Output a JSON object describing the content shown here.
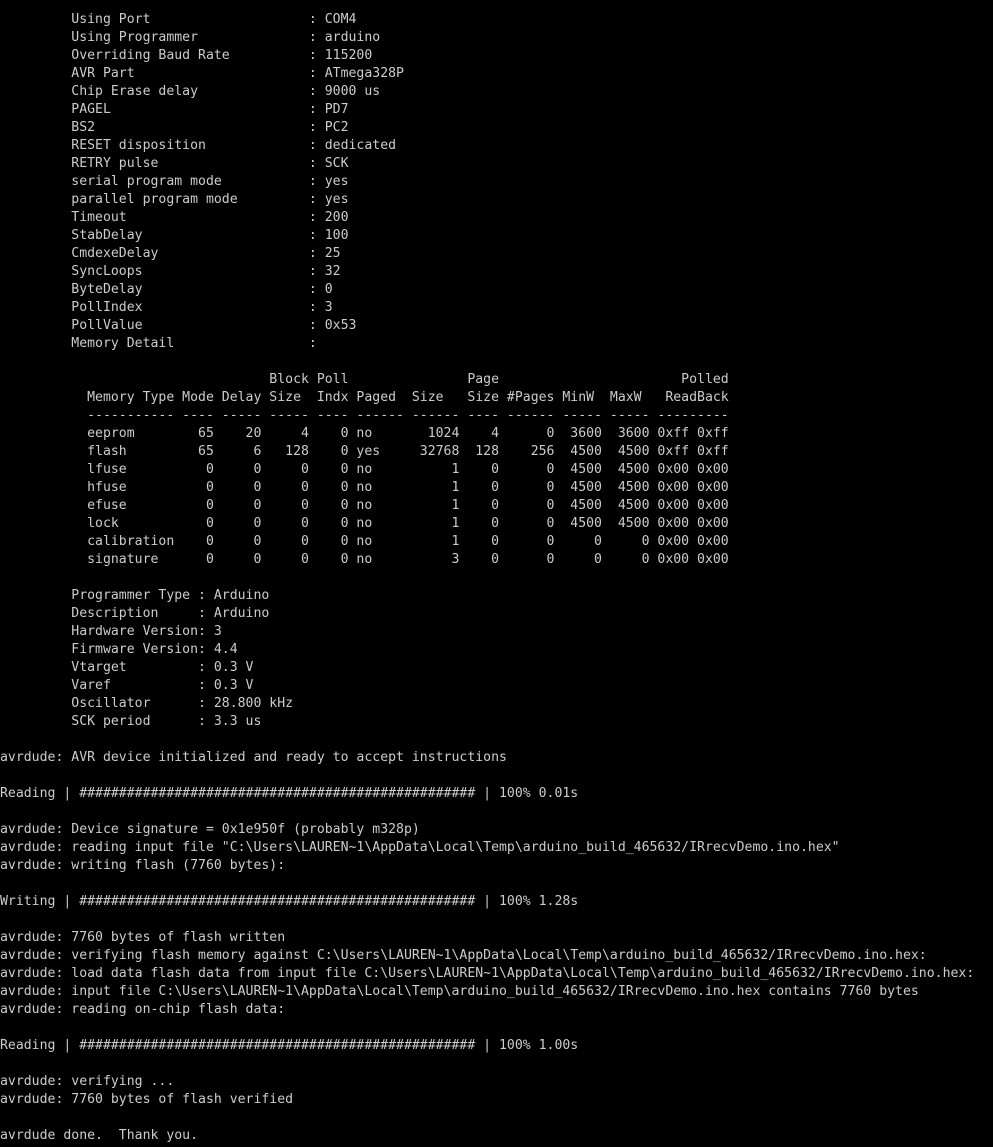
{
  "console": {
    "lines": [
      "         Using Port                    : COM4",
      "         Using Programmer              : arduino",
      "         Overriding Baud Rate          : 115200",
      "         AVR Part                      : ATmega328P",
      "         Chip Erase delay              : 9000 us",
      "         PAGEL                         : PD7",
      "         BS2                           : PC2",
      "         RESET disposition             : dedicated",
      "         RETRY pulse                   : SCK",
      "         serial program mode           : yes",
      "         parallel program mode         : yes",
      "         Timeout                       : 200",
      "         StabDelay                     : 100",
      "         CmdexeDelay                   : 25",
      "         SyncLoops                     : 32",
      "         ByteDelay                     : 0",
      "         PollIndex                     : 3",
      "         PollValue                     : 0x53",
      "         Memory Detail                 :",
      "",
      "                                  Block Poll               Page                       Polled",
      "           Memory Type Mode Delay Size  Indx Paged  Size   Size #Pages MinW  MaxW   ReadBack",
      "           ----------- ---- ----- ----- ---- ------ ------ ---- ------ ----- ----- ---------",
      "           eeprom        65    20     4    0 no       1024    4      0  3600  3600 0xff 0xff",
      "           flash         65     6   128    0 yes     32768  128    256  4500  4500 0xff 0xff",
      "           lfuse          0     0     0    0 no          1    0      0  4500  4500 0x00 0x00",
      "           hfuse          0     0     0    0 no          1    0      0  4500  4500 0x00 0x00",
      "           efuse          0     0     0    0 no          1    0      0  4500  4500 0x00 0x00",
      "           lock           0     0     0    0 no          1    0      0  4500  4500 0x00 0x00",
      "           calibration    0     0     0    0 no          1    0      0     0     0 0x00 0x00",
      "           signature      0     0     0    0 no          3    0      0     0     0 0x00 0x00",
      "",
      "         Programmer Type : Arduino",
      "         Description     : Arduino",
      "         Hardware Version: 3",
      "         Firmware Version: 4.4",
      "         Vtarget         : 0.3 V",
      "         Varef           : 0.3 V",
      "         Oscillator      : 28.800 kHz",
      "         SCK period      : 3.3 us",
      "",
      "avrdude: AVR device initialized and ready to accept instructions",
      "",
      "Reading | ################################################## | 100% 0.01s",
      "",
      "avrdude: Device signature = 0x1e950f (probably m328p)",
      "avrdude: reading input file \"C:\\Users\\LAUREN~1\\AppData\\Local\\Temp\\arduino_build_465632/IRrecvDemo.ino.hex\"",
      "avrdude: writing flash (7760 bytes):",
      "",
      "Writing | ################################################## | 100% 1.28s",
      "",
      "avrdude: 7760 bytes of flash written",
      "avrdude: verifying flash memory against C:\\Users\\LAUREN~1\\AppData\\Local\\Temp\\arduino_build_465632/IRrecvDemo.ino.hex:",
      "avrdude: load data flash data from input file C:\\Users\\LAUREN~1\\AppData\\Local\\Temp\\arduino_build_465632/IRrecvDemo.ino.hex:",
      "avrdude: input file C:\\Users\\LAUREN~1\\AppData\\Local\\Temp\\arduino_build_465632/IRrecvDemo.ino.hex contains 7760 bytes",
      "avrdude: reading on-chip flash data:",
      "",
      "Reading | ################################################## | 100% 1.00s",
      "",
      "avrdude: verifying ...",
      "avrdude: 7760 bytes of flash verified",
      "",
      "avrdude done.  Thank you."
    ]
  }
}
